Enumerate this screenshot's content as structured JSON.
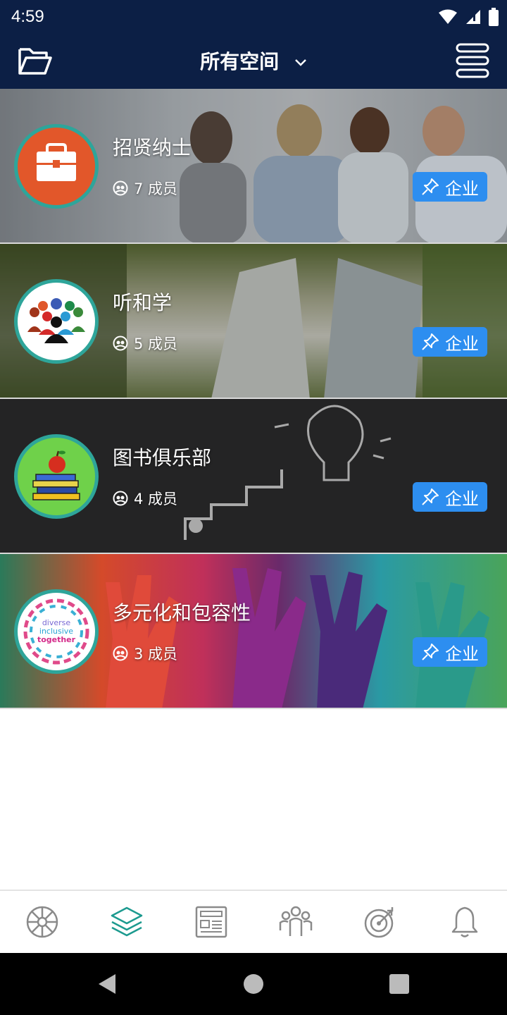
{
  "status": {
    "time": "4:59"
  },
  "header": {
    "title": "所有空间",
    "folder_icon": "folder-open-icon",
    "menu_icon": "stacked-menu-icon"
  },
  "spaces": [
    {
      "name": "招贤纳士",
      "members": "7 成员",
      "badge": "企业",
      "avatar": "briefcase-icon",
      "accent": "#e2572a"
    },
    {
      "name": "听和学",
      "members": "5 成员",
      "badge": "企业",
      "avatar": "people-group-icon",
      "accent": "#ffffff"
    },
    {
      "name": "图书俱乐部",
      "members": "4 成员",
      "badge": "企业",
      "avatar": "books-apple-icon",
      "accent": "#6fd14a"
    },
    {
      "name": "多元化和包容性",
      "members": "3 成员",
      "badge": "企业",
      "avatar": "diverse-inclusive-together-logo",
      "avatar_text": [
        "diverse",
        "inclusive",
        "together"
      ]
    }
  ],
  "bottom_nav": [
    {
      "icon": "wheel-icon",
      "active": false
    },
    {
      "icon": "layers-icon",
      "active": true
    },
    {
      "icon": "newspaper-icon",
      "active": false
    },
    {
      "icon": "people-icon",
      "active": false
    },
    {
      "icon": "target-icon",
      "active": false
    },
    {
      "icon": "bell-icon",
      "active": false
    }
  ],
  "colors": {
    "header_bg": "#0c1f45",
    "badge_bg": "#2d8ef0",
    "active_nav": "#1c9a8f",
    "inactive_nav": "#8a8a8a",
    "avatar_ring": "#2ea59a"
  }
}
